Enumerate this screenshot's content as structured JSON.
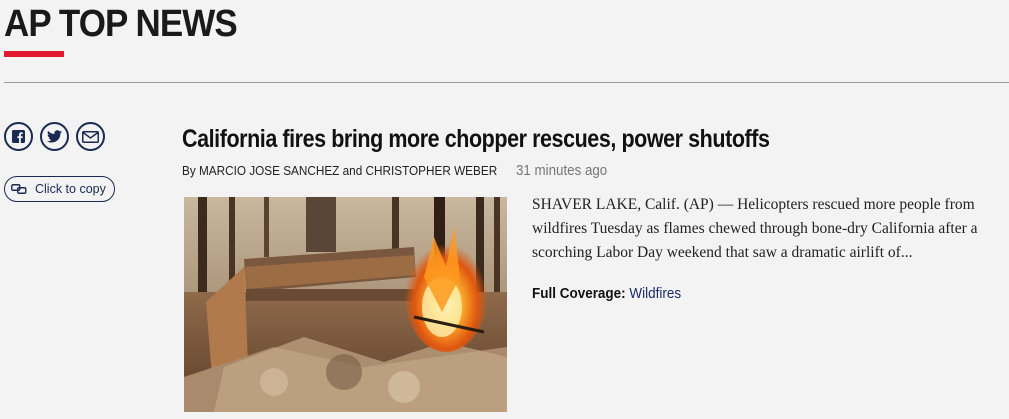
{
  "section": {
    "title": "AP TOP NEWS",
    "accent_color": "#e3172d"
  },
  "share": {
    "buttons": [
      {
        "icon": "facebook-icon"
      },
      {
        "icon": "twitter-icon"
      },
      {
        "icon": "email-icon"
      }
    ],
    "copy_label": "Click to copy"
  },
  "article": {
    "headline": "California fires bring more chopper rescues, power shutoffs",
    "byline": {
      "prefix": "By",
      "author1": "MARCIO JOSE SANCHEZ",
      "conjunction": "and",
      "author2": "CHRISTOPHER WEBER"
    },
    "timestamp": "31 minutes ago",
    "image_description_icon": "wildfire-photo",
    "summary": "SHAVER LAKE, Calif. (AP) — Helicopters rescued more people from wildfires Tuesday as flames chewed through bone-dry California after a scorching Labor Day weekend that saw a dramatic airlift of...",
    "coverage": {
      "label": "Full Coverage:",
      "link": "Wildfires"
    }
  },
  "colors": {
    "navy": "#1b2a52",
    "link": "#1b2a6b",
    "background": "#f3f3f3"
  }
}
